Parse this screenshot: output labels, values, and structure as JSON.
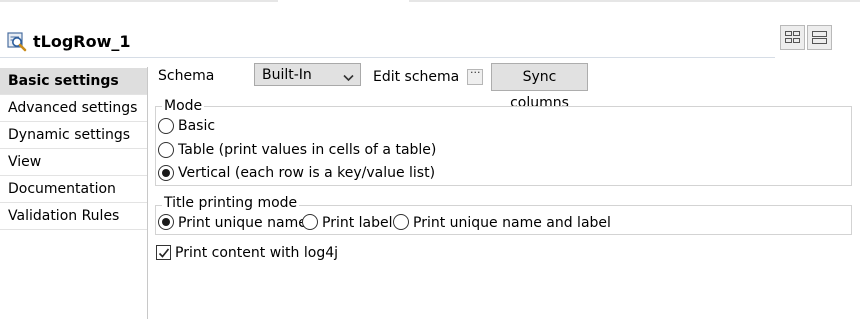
{
  "component": {
    "title": "tLogRow_1",
    "icon": "log-row-icon"
  },
  "toolbar": {
    "layout_buttons": [
      "grid-layout-icon",
      "stack-layout-icon"
    ]
  },
  "sidebar": {
    "items": [
      {
        "label": "Basic settings",
        "active": true
      },
      {
        "label": "Advanced settings",
        "active": false
      },
      {
        "label": "Dynamic settings",
        "active": false
      },
      {
        "label": "View",
        "active": false
      },
      {
        "label": "Documentation",
        "active": false
      },
      {
        "label": "Validation Rules",
        "active": false
      }
    ]
  },
  "schema": {
    "label": "Schema",
    "selected": "Built-In",
    "edit_label": "Edit schema",
    "edit_button": "...",
    "sync_button": "Sync columns"
  },
  "mode": {
    "legend": "Mode",
    "options": [
      {
        "label": "Basic",
        "checked": false
      },
      {
        "label": "Table (print values in cells of a table)",
        "checked": false
      },
      {
        "label": "Vertical (each row is a key/value list)",
        "checked": true
      }
    ]
  },
  "title_printing": {
    "legend": "Title printing mode",
    "options": [
      {
        "label": "Print unique name",
        "checked": true
      },
      {
        "label": "Print label",
        "checked": false
      },
      {
        "label": "Print unique name and label",
        "checked": false
      }
    ]
  },
  "log4j": {
    "label": "Print content with log4j",
    "checked": true
  },
  "colors": {
    "active_sidebar_bg": "#dedede",
    "button_bg": "#e1e1e1",
    "border": "#d3d3d3"
  }
}
